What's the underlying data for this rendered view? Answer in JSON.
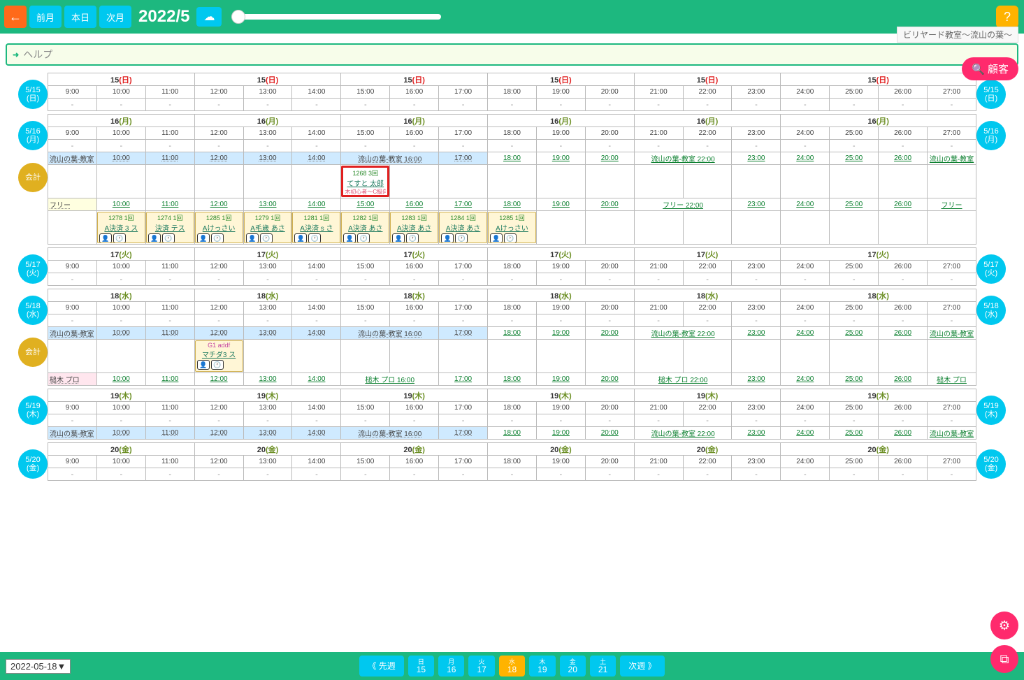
{
  "header": {
    "back": "←",
    "prev_month": "前月",
    "today": "本日",
    "next_month": "次月",
    "date": "2022/5",
    "cloud": "☁",
    "help": "?",
    "subtitle": "ビリヤード教室～流山の葉～",
    "helpbar": "ヘルプ",
    "customer": "顧客",
    "search": "🔍"
  },
  "times": [
    "9:00",
    "10:00",
    "11:00",
    "12:00",
    "13:00",
    "14:00",
    "15:00",
    "16:00",
    "17:00",
    "18:00",
    "19:00",
    "20:00",
    "21:00",
    "22:00",
    "23:00",
    "24:00",
    "25:00",
    "26:00",
    "27:00"
  ],
  "days": [
    {
      "id": "d15",
      "badge": "5/15",
      "dow": "(日)",
      "dowcls": "red",
      "header": "15",
      "dowH": "(日)",
      "rooms": []
    },
    {
      "id": "d16",
      "badge": "5/16",
      "dow": "(月)",
      "dowcls": "",
      "header": "16",
      "dowH": "(月)",
      "kaikei": true,
      "rooms": [
        {
          "label": "流山の葉-教室",
          "cls": "blue",
          "times": [
            "10:00",
            "11:00",
            "12:00",
            "13:00",
            "14:00",
            "流山の葉-教室 16:00",
            "17:00",
            "18:00",
            "19:00",
            "20:00",
            "流山の葉-教室 22:00",
            "23:00",
            "24:00",
            "25:00",
            "26:00",
            "流山の葉-教室"
          ],
          "splits": [
            1,
            1,
            1,
            1,
            1,
            2,
            1,
            1,
            1,
            1,
            2,
            1,
            1,
            1,
            1,
            1
          ],
          "blues": [
            0,
            1,
            2,
            3,
            4,
            5,
            6
          ],
          "appts": [
            {
              "col": 6,
              "cls": "highlight",
              "code": "1268 3回",
              "name": "てすと 太郎",
              "sub": "木初心者～C級向け体験レ",
              "nameCls": ""
            }
          ]
        },
        {
          "label": "フリー",
          "cls": "yellow",
          "times": [
            "10:00",
            "11:00",
            "12:00",
            "13:00",
            "14:00",
            "15:00",
            "16:00",
            "17:00",
            "18:00",
            "19:00",
            "20:00",
            "フリー 22:00",
            "23:00",
            "24:00",
            "25:00",
            "26:00",
            "フリー"
          ],
          "splits": [
            1,
            1,
            1,
            1,
            1,
            1,
            1,
            1,
            1,
            1,
            1,
            2,
            1,
            1,
            1,
            1,
            1
          ],
          "blues": [],
          "appts": [
            {
              "col": 1,
              "cls": "yellow",
              "code": "1278 1回",
              "name": "A決済 3 ス",
              "sub": ""
            },
            {
              "col": 2,
              "cls": "yellow",
              "code": "1274 1回",
              "name": "決済 テス",
              "sub": ""
            },
            {
              "col": 3,
              "cls": "yellow",
              "code": "1285 1回",
              "name": "Aけっさい",
              "sub": ""
            },
            {
              "col": 4,
              "cls": "yellow",
              "code": "1279 1回",
              "name": "A毛歳 あさ",
              "sub": ""
            },
            {
              "col": 5,
              "cls": "yellow",
              "code": "1281 1回",
              "name": "A決済  s さ",
              "sub": ""
            },
            {
              "col": 6,
              "cls": "yellow",
              "code": "1282 1回",
              "name": "A決済 あさ",
              "sub": ""
            },
            {
              "col": 7,
              "cls": "yellow",
              "code": "1283 1回",
              "name": "A決済 あさ",
              "sub": ""
            },
            {
              "col": 8,
              "cls": "yellow",
              "code": "1284 1回",
              "name": "A決済 あさ",
              "sub": ""
            },
            {
              "col": 9,
              "cls": "yellow",
              "code": "1285 1回",
              "name": "Aけっさい",
              "sub": ""
            }
          ]
        }
      ]
    },
    {
      "id": "d17",
      "badge": "5/17",
      "dow": "(火)",
      "dowcls": "",
      "header": "17",
      "dowH": "(火)",
      "rooms": []
    },
    {
      "id": "d18",
      "badge": "5/18",
      "dow": "(水)",
      "dowcls": "",
      "header": "18",
      "dowH": "(水)",
      "kaikei": true,
      "rooms": [
        {
          "label": "流山の葉-教室",
          "cls": "blue",
          "times": [
            "10:00",
            "11:00",
            "12:00",
            "13:00",
            "14:00",
            "流山の葉-教室 16:00",
            "17:00",
            "18:00",
            "19:00",
            "20:00",
            "流山の葉-教室 22:00",
            "23:00",
            "24:00",
            "25:00",
            "26:00",
            "流山の葉-教室"
          ],
          "splits": [
            1,
            1,
            1,
            1,
            1,
            2,
            1,
            1,
            1,
            1,
            2,
            1,
            1,
            1,
            1,
            1
          ],
          "blues": [
            0,
            1,
            2,
            3,
            4,
            5,
            6
          ],
          "appts": [
            {
              "col": 3,
              "cls": "yellow",
              "code": "G1 addf",
              "name": "マチダ3 ス",
              "sub": "",
              "codeCls": "mag"
            }
          ]
        },
        {
          "label": "槌木 プロ",
          "cls": "pink",
          "times": [
            "10:00",
            "11:00",
            "12:00",
            "13:00",
            "14:00",
            "槌木 プロ 16:00",
            "17:00",
            "18:00",
            "19:00",
            "20:00",
            "槌木 プロ 22:00",
            "23:00",
            "24:00",
            "25:00",
            "26:00",
            "槌木 プロ"
          ],
          "splits": [
            1,
            1,
            1,
            1,
            1,
            2,
            1,
            1,
            1,
            1,
            2,
            1,
            1,
            1,
            1,
            1
          ],
          "blues": [],
          "appts": [],
          "noslot": true
        }
      ]
    },
    {
      "id": "d19",
      "badge": "5/19",
      "dow": "(木)",
      "dowcls": "",
      "header": "19",
      "dowH": "(木)",
      "rooms": [
        {
          "label": "流山の葉-教室",
          "cls": "blue",
          "times": [
            "10:00",
            "11:00",
            "12:00",
            "13:00",
            "14:00",
            "流山の葉-教室 16:00",
            "17:00",
            "18:00",
            "19:00",
            "20:00",
            "流山の葉-教室 22:00",
            "23:00",
            "24:00",
            "25:00",
            "26:00",
            "流山の葉-教室"
          ],
          "splits": [
            1,
            1,
            1,
            1,
            1,
            2,
            1,
            1,
            1,
            1,
            2,
            1,
            1,
            1,
            1,
            1
          ],
          "blues": [
            0,
            1,
            2,
            3,
            4,
            5,
            6
          ],
          "appts": [],
          "noslot": true
        }
      ]
    },
    {
      "id": "d20",
      "badge": "5/20",
      "dow": "(金)",
      "dowcls": "",
      "header": "20",
      "dowH": "(金)",
      "rooms": []
    }
  ],
  "footer": {
    "date_input": "2022-05-18▼",
    "prev_week": "《 先週",
    "next_week": "次週 》",
    "days": [
      {
        "dow": "日",
        "num": "15"
      },
      {
        "dow": "月",
        "num": "16"
      },
      {
        "dow": "火",
        "num": "17"
      },
      {
        "dow": "水",
        "num": "18",
        "active": true
      },
      {
        "dow": "木",
        "num": "19"
      },
      {
        "dow": "金",
        "num": "20"
      },
      {
        "dow": "土",
        "num": "21"
      }
    ]
  },
  "icons": {
    "person": "👤",
    "clock": "🕐",
    "gear": "⚙",
    "copy": "⧉"
  }
}
